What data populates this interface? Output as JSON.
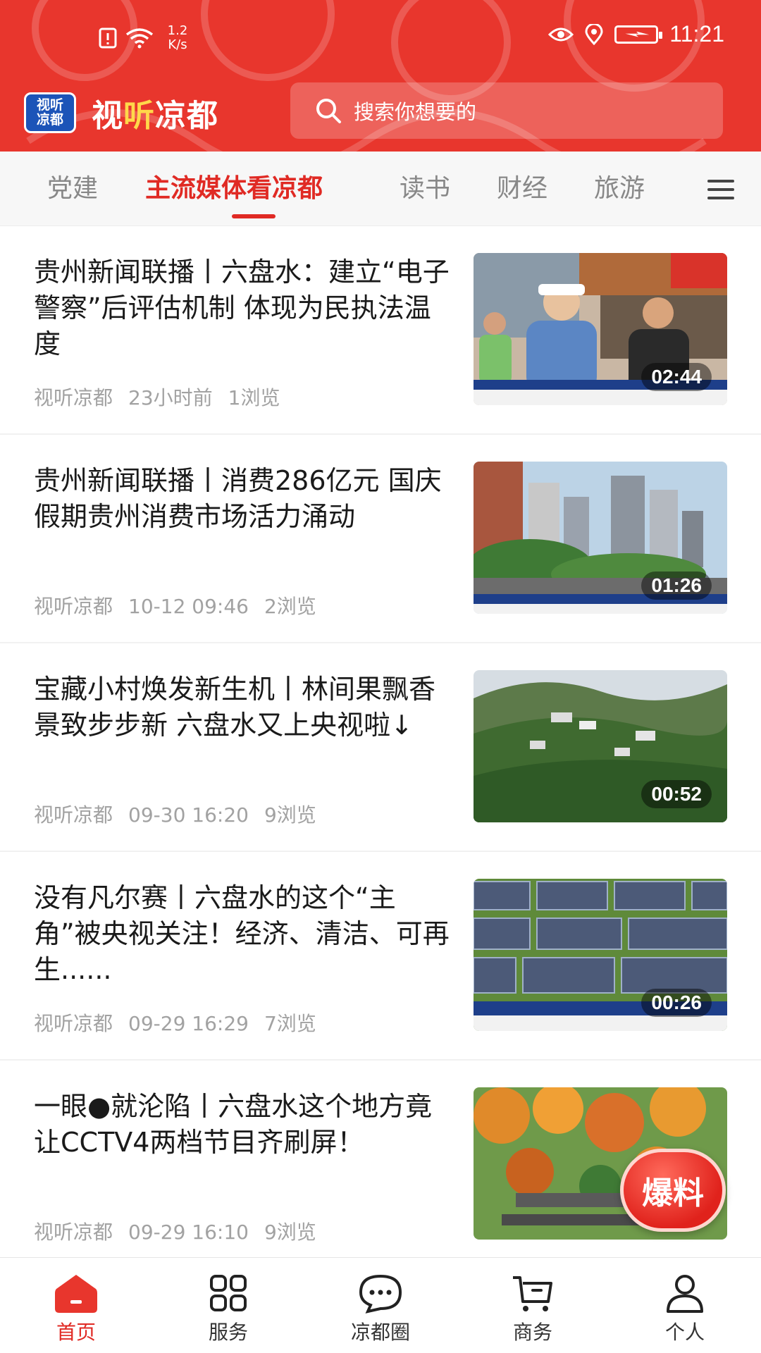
{
  "status_bar": {
    "net_speed_value": "1.2",
    "net_speed_unit": "K/s",
    "time": "11:21",
    "icons": [
      "alert-icon",
      "wifi-icon",
      "eye-icon",
      "location-icon",
      "battery-charging-icon"
    ]
  },
  "header": {
    "logo_line1": "视听",
    "logo_line2": "凉都",
    "app_name_a": "视",
    "app_name_b": "听",
    "app_name_c": "凉都",
    "search_placeholder": "搜索你想要的"
  },
  "tabs": [
    {
      "label": "党建",
      "active": false
    },
    {
      "label": "主流媒体看凉都",
      "active": true
    },
    {
      "label": "读书",
      "active": false
    },
    {
      "label": "财经",
      "active": false
    },
    {
      "label": "旅游",
      "active": false
    }
  ],
  "news": [
    {
      "title": "贵州新闻联播丨六盘水：建立“电子警察”后评估机制 体现为民执法温度",
      "source": "视听凉都",
      "time": "23小时前",
      "views": "1浏览",
      "duration": "02:44",
      "thumb": "police-scene"
    },
    {
      "title": "贵州新闻联播丨消费286亿元 国庆假期贵州消费市场活力涌动",
      "source": "视听凉都",
      "time": "10-12 09:46",
      "views": "2浏览",
      "duration": "01:26",
      "thumb": "city-buildings"
    },
    {
      "title": "宝藏小村焕发新生机丨林间果飘香 景致步步新 六盘水又上央视啦↓",
      "source": "视听凉都",
      "time": "09-30 16:20",
      "views": "9浏览",
      "duration": "00:52",
      "thumb": "mountain-village"
    },
    {
      "title": "没有凡尔赛丨六盘水的这个“主角”被央视关注！经济、清洁、可再生......",
      "source": "视听凉都",
      "time": "09-29 16:29",
      "views": "7浏览",
      "duration": "00:26",
      "thumb": "solar-panels"
    },
    {
      "title": "一眼●就沦陷丨六盘水这个地方竟让CCTV4两档节目齐刷屏！",
      "source": "视听凉都",
      "time": "09-29 16:10",
      "views": "9浏览",
      "duration": "",
      "thumb": "autumn-trees"
    }
  ],
  "fab": {
    "label": "爆料"
  },
  "bottom_nav": [
    {
      "label": "首页",
      "icon": "home-icon",
      "active": true
    },
    {
      "label": "服务",
      "icon": "grid-icon",
      "active": false
    },
    {
      "label": "凉都圈",
      "icon": "chat-bubble-icon",
      "active": false
    },
    {
      "label": "商务",
      "icon": "cart-icon",
      "active": false
    },
    {
      "label": "个人",
      "icon": "person-icon",
      "active": false
    }
  ],
  "colors": {
    "brand_red": "#e8362d",
    "active_red": "#e02a24",
    "meta_gray": "#a2a2a2"
  }
}
